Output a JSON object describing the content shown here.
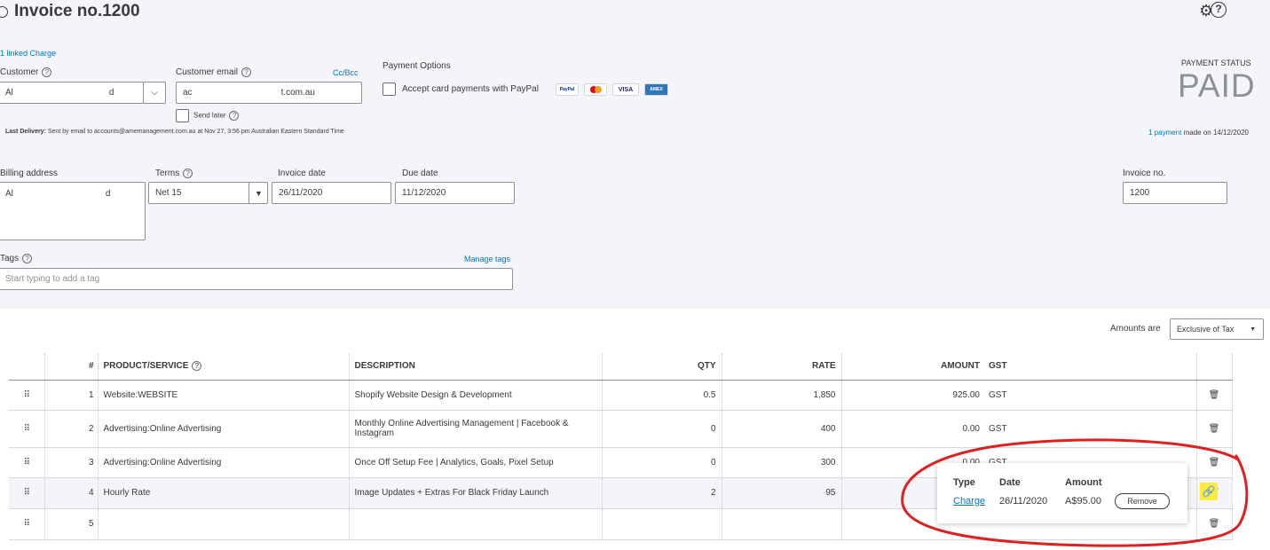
{
  "header": {
    "title": "Invoice no.1200",
    "settings_icon": "gear-icon",
    "help_icon": "help-icon",
    "help_glyph": "?",
    "linked_charge": "1 linked Charge"
  },
  "customer": {
    "label": "Customer",
    "value_start": "Al",
    "value_end": "d"
  },
  "email": {
    "label": "Customer email",
    "cc_bcc": "Cc/Bcc",
    "value_start": "ac",
    "value_end": "t.com.au",
    "send_later": "Send later"
  },
  "payment_options": {
    "label": "Payment Options",
    "paypal_text": "Accept card payments with PayPal",
    "cards": [
      "PayPal",
      "",
      "VISA",
      "AMEX"
    ]
  },
  "payment_status": {
    "label": "PAYMENT STATUS",
    "value": "PAID",
    "payment_link": "1 payment",
    "payment_suffix": "made on 14/12/2020"
  },
  "last_delivery": {
    "label": "Last Delivery:",
    "text": "Sent by email to accounts@amemanagement.com.au at Nov 27, 3:56 pm Australian Eastern Standard Time"
  },
  "billing": {
    "label": "Billing address",
    "value_start": "Al",
    "value_end": "d"
  },
  "terms": {
    "label": "Terms",
    "value": "Net 15"
  },
  "invoice_date": {
    "label": "Invoice date",
    "value": "26/11/2020"
  },
  "due_date": {
    "label": "Due date",
    "value": "11/12/2020"
  },
  "invoice_no": {
    "label": "Invoice no.",
    "value": "1200"
  },
  "tags": {
    "label": "Tags",
    "manage": "Manage tags",
    "placeholder": "Start typing to add a tag"
  },
  "amounts_are": {
    "label": "Amounts are",
    "value": "Exclusive of Tax"
  },
  "table": {
    "headers": {
      "num": "#",
      "product": "PRODUCT/SERVICE",
      "description": "DESCRIPTION",
      "qty": "QTY",
      "rate": "RATE",
      "amount": "AMOUNT",
      "gst": "GST"
    },
    "rows": [
      {
        "num": "1",
        "product": "Website:WEBSITE",
        "description": "Shopify Website Design & Development",
        "qty": "0.5",
        "rate": "1,850",
        "amount": "925.00",
        "gst": "GST"
      },
      {
        "num": "2",
        "product": "Advertising:Online Advertising",
        "description": "Monthly Online Advertising Management | Facebook & Instagram",
        "qty": "0",
        "rate": "400",
        "amount": "0.00",
        "gst": "GST"
      },
      {
        "num": "3",
        "product": "Advertising:Online Advertising",
        "description": "Once Off Setup Fee | Analytics, Goals, Pixel Setup",
        "qty": "0",
        "rate": "300",
        "amount": "0.00",
        "gst": "GST"
      },
      {
        "num": "4",
        "product": "Hourly Rate",
        "description": "Image Updates + Extras For Black Friday Launch",
        "qty": "2",
        "rate": "95",
        "amount": "",
        "gst": ""
      },
      {
        "num": "5",
        "product": "",
        "description": "",
        "qty": "",
        "rate": "",
        "amount": "",
        "gst": ""
      }
    ]
  },
  "popup": {
    "type_label": "Type",
    "date_label": "Date",
    "amount_label": "Amount",
    "type_value": "Charge",
    "date_value": "26/11/2020",
    "amount_value": "A$95.00",
    "remove": "Remove"
  },
  "annotation_color": "#e02020"
}
